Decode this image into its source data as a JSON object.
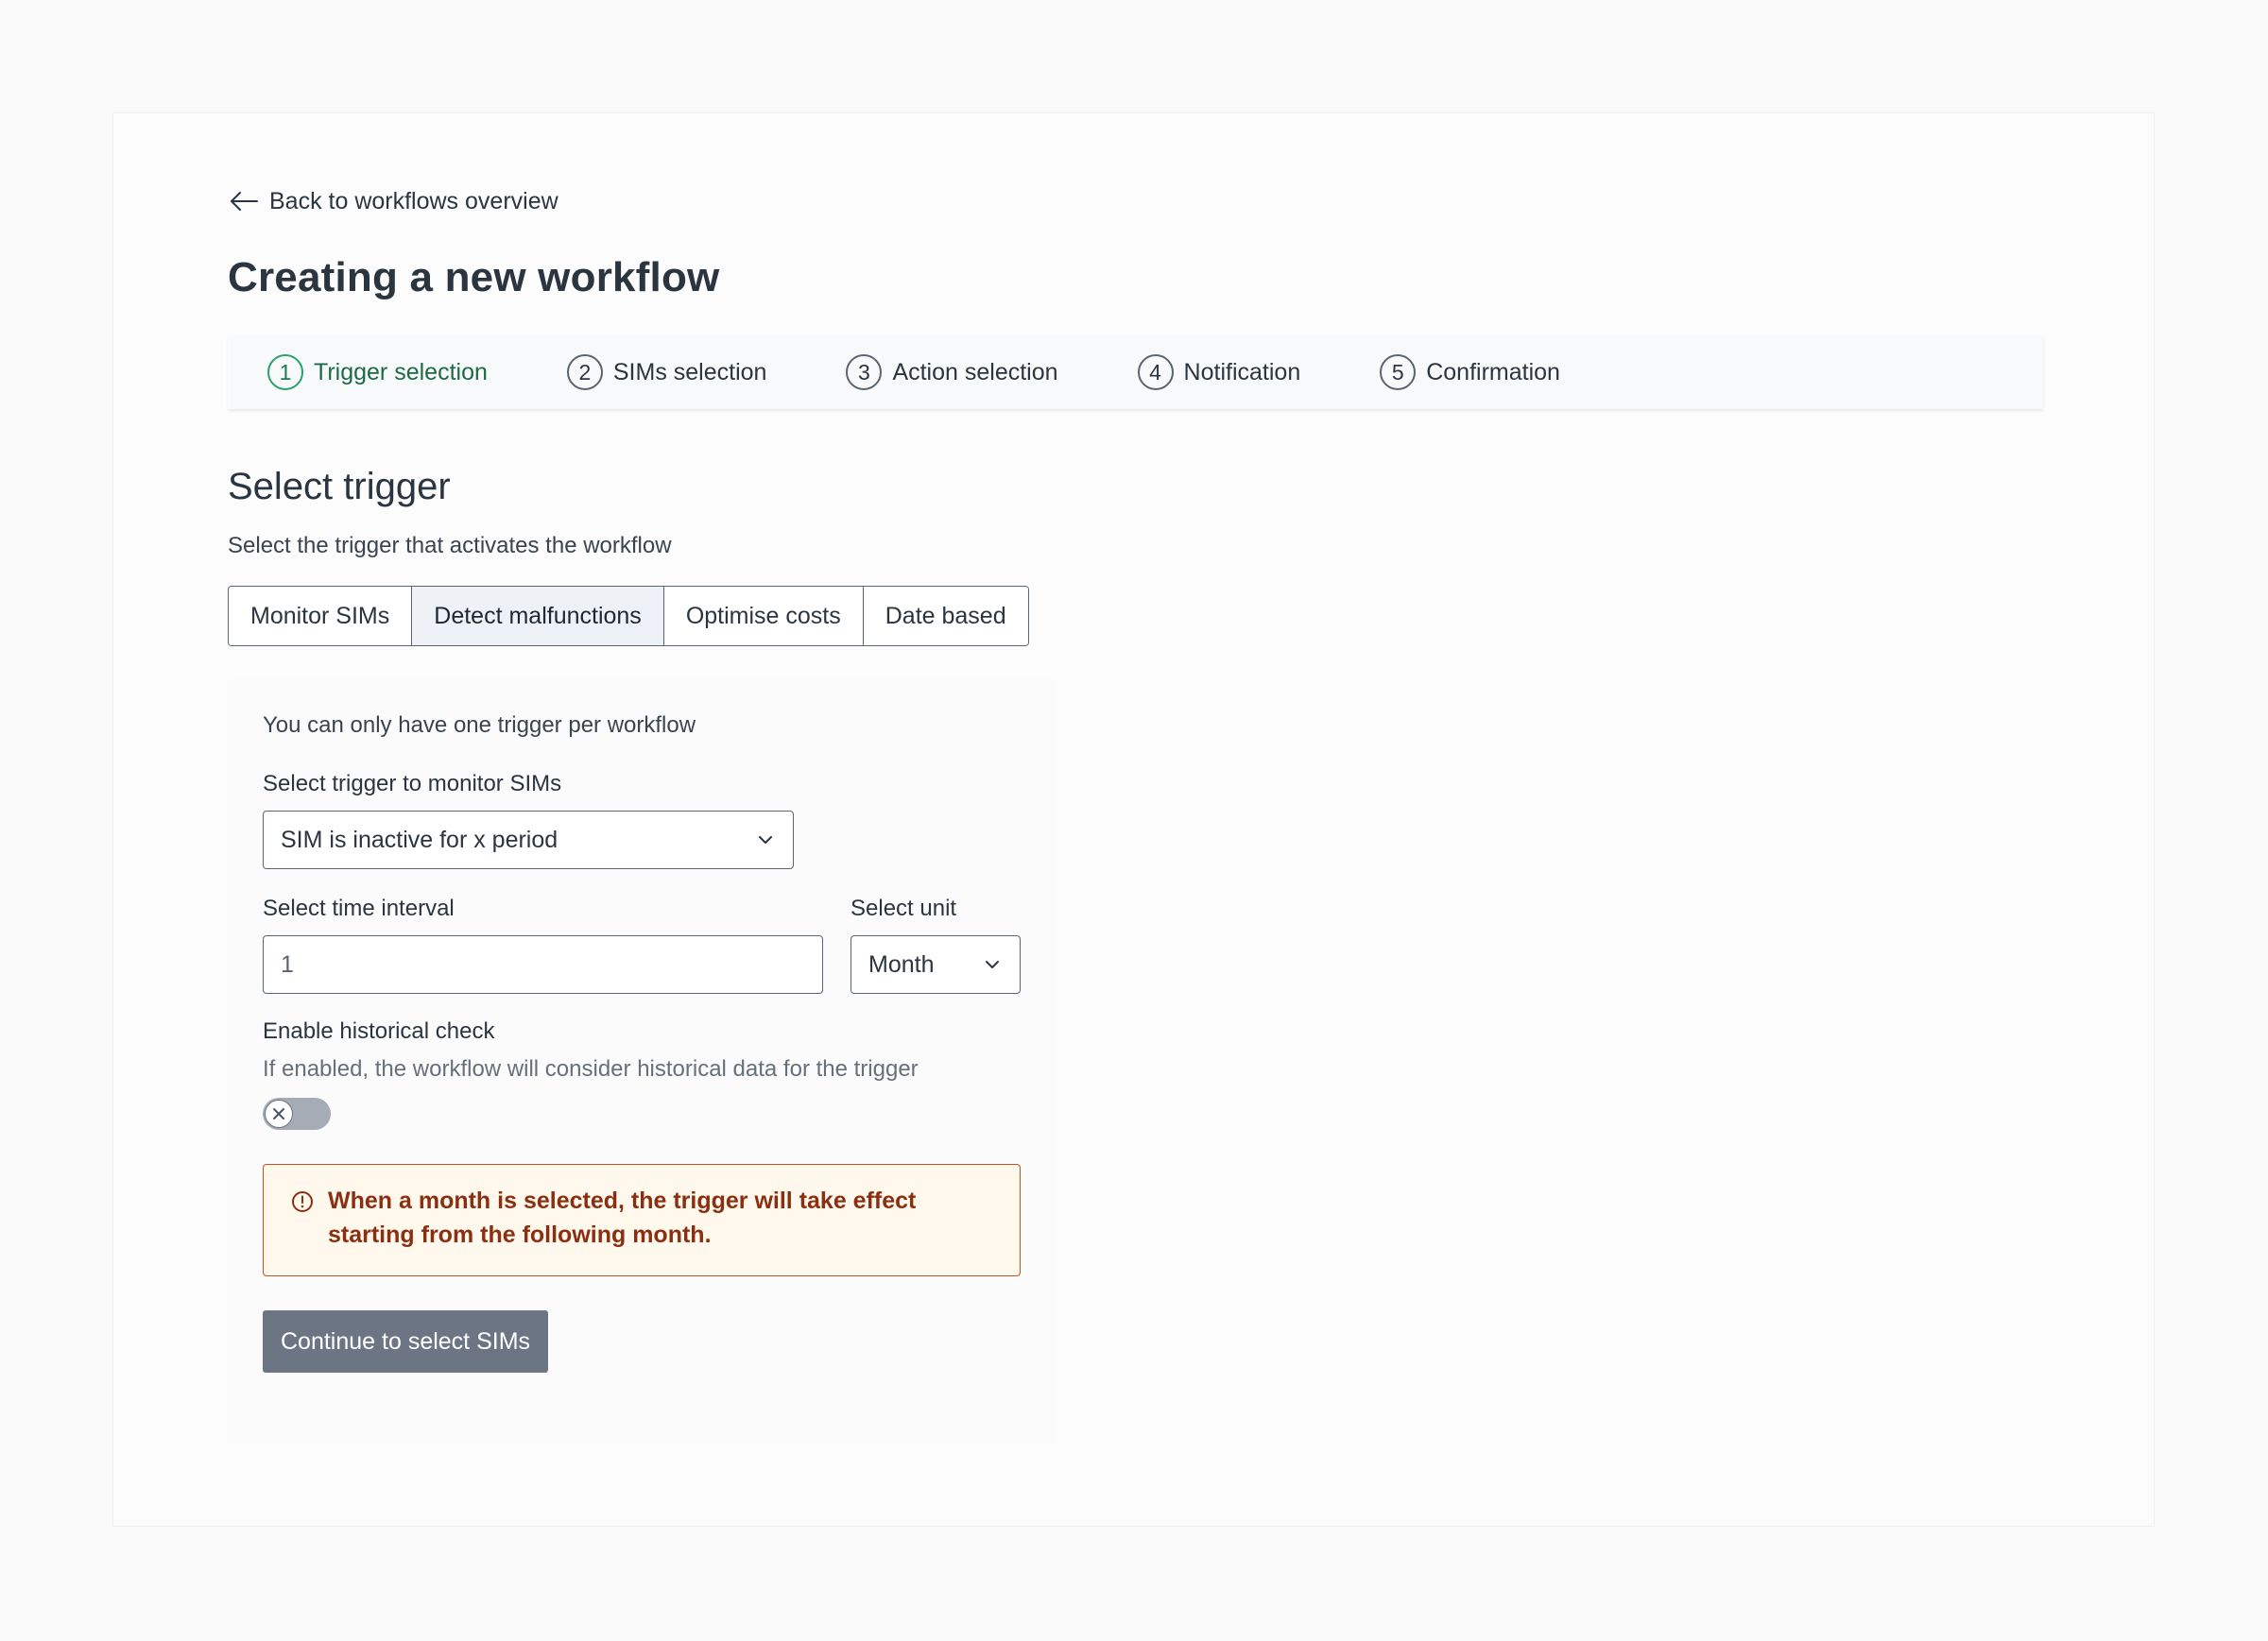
{
  "nav": {
    "back_label": "Back to workflows overview"
  },
  "page": {
    "title": "Creating a new workflow"
  },
  "steps": [
    {
      "num": "1",
      "label": "Trigger selection"
    },
    {
      "num": "2",
      "label": "SIMs selection"
    },
    {
      "num": "3",
      "label": "Action selection"
    },
    {
      "num": "4",
      "label": "Notification"
    },
    {
      "num": "5",
      "label": "Confirmation"
    }
  ],
  "section": {
    "title": "Select trigger",
    "subtitle": "Select the trigger that activates the workflow"
  },
  "tabs": [
    {
      "label": "Monitor SIMs"
    },
    {
      "label": "Detect malfunctions"
    },
    {
      "label": "Optimise costs"
    },
    {
      "label": "Date based"
    }
  ],
  "form": {
    "note": "You can only have one trigger per workflow",
    "trigger_label": "Select trigger to monitor SIMs",
    "trigger_value": "SIM is inactive for x period",
    "interval_label": "Select time interval",
    "interval_value": "1",
    "unit_label": "Select unit",
    "unit_value": "Month",
    "historical_label": "Enable historical check",
    "historical_helper": "If enabled, the workflow will consider historical data for the trigger",
    "alert_line1": "When a month is selected, the trigger will take effect",
    "alert_line2": "starting from the following month.",
    "continue_label": "Continue to select SIMs"
  },
  "colors": {
    "accent_green": "#29a36a",
    "alert_border": "#c8501f",
    "alert_text": "#8a2f12",
    "button_bg": "#6b7584"
  }
}
